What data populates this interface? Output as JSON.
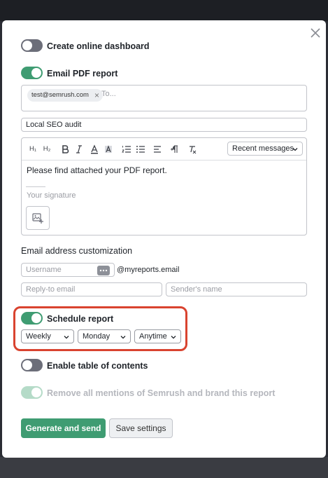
{
  "dialog": {
    "close_label": "close"
  },
  "dashboard_toggle": {
    "label": "Create online dashboard",
    "enabled": false
  },
  "email_toggle": {
    "label": "Email PDF report",
    "enabled": true
  },
  "recipients": {
    "chips": [
      "test@semrush.com"
    ],
    "to_placeholder": "To..."
  },
  "subject": {
    "value": "Local SEO audit"
  },
  "editor": {
    "toolbar": {
      "h1": "H₁",
      "h2": "H₂",
      "recent_messages": "Recent messages"
    },
    "body_text": "Please find attached your PDF report.",
    "signature_placeholder": "Your signature"
  },
  "customization": {
    "title": "Email address customization",
    "username_placeholder": "Username",
    "domain": "@myreports.email",
    "reply_to_placeholder": "Reply-to email",
    "sender_name_placeholder": "Sender's name"
  },
  "schedule": {
    "label": "Schedule report",
    "enabled": true,
    "frequency": "Weekly",
    "day": "Monday",
    "time": "Anytime"
  },
  "toc_toggle": {
    "label": "Enable table of contents",
    "enabled": false
  },
  "branding_toggle": {
    "label": "Remove all mentions of Semrush and brand this report",
    "enabled": true,
    "disabled": true
  },
  "actions": {
    "generate_label": "Generate and send",
    "save_label": "Save settings"
  },
  "colors": {
    "accent": "#3f9c72",
    "highlight": "#d9432f"
  }
}
